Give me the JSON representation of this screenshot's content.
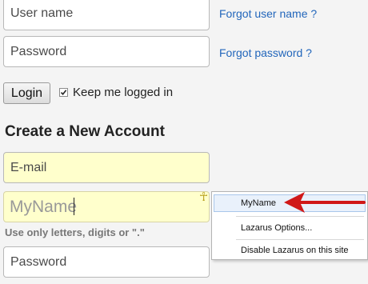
{
  "login": {
    "username_placeholder": "User name",
    "password_placeholder": "Password",
    "forgot_username": "Forgot user name ?",
    "forgot_password": "Forgot password ?",
    "login_button": "Login",
    "keep_logged_in": "Keep me logged in",
    "keep_logged_in_checked": true
  },
  "create_account": {
    "heading": "Create a New Account",
    "email_placeholder": "E-mail",
    "username_value": "MyName",
    "username_hint": "Use only letters, digits or \".\"",
    "password_placeholder": "Password"
  },
  "context_menu": {
    "items": [
      "MyName",
      "Lazarus Options...",
      "Disable Lazarus on this site"
    ],
    "selected_index": 0
  },
  "icons": {
    "lazarus": "ankh-icon",
    "annotation": "red-arrow-icon"
  },
  "colors": {
    "link": "#2266bb",
    "autofill_field": "#ffffcc",
    "arrow": "#d01818"
  }
}
